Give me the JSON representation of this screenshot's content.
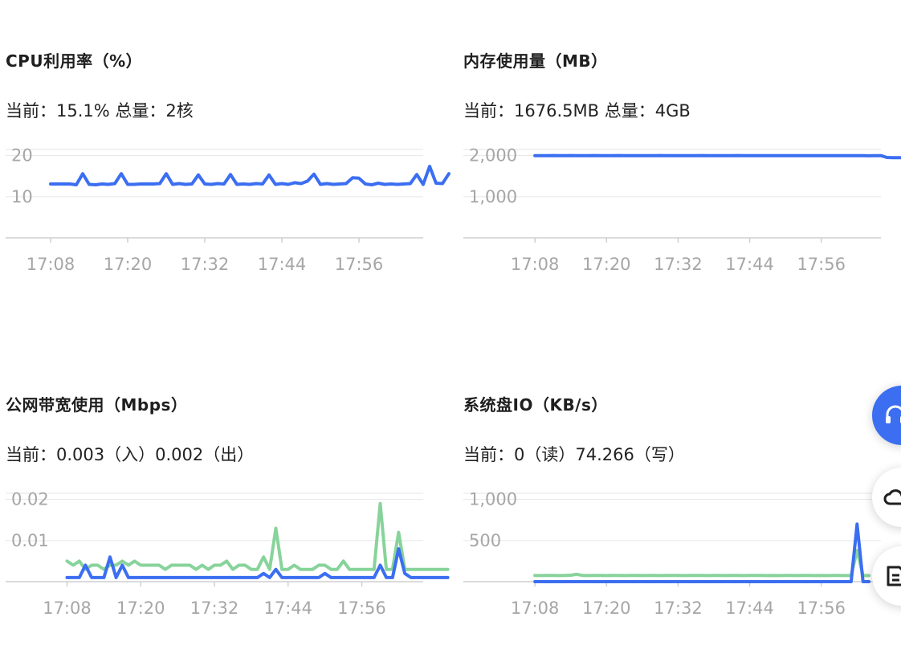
{
  "panels": {
    "cpu": {
      "title": "CPU利用率（%）",
      "current_label": "当前：",
      "current_value": "15.1%",
      "total_label": "总量：",
      "total_value": "2核"
    },
    "mem": {
      "title": "内存使用量（MB）",
      "current_label": "当前：",
      "current_value": "1676.5MB",
      "total_label": "总量：",
      "total_value": "4GB"
    },
    "net": {
      "title": "公网带宽使用（Mbps）",
      "current_label": "当前：",
      "current_in": "0.003（入）",
      "current_out": "0.002（出）"
    },
    "io": {
      "title": "系统盘IO（KB/s）",
      "current_label": "当前：",
      "current_read": "0（读）",
      "current_write": "74.266（写）"
    }
  },
  "colors": {
    "blue": "#3b6ef1",
    "green": "#88d39b",
    "axis_text": "#a6a6a6",
    "grid": "#e6e6e6",
    "axis": "#cfcfcf"
  },
  "fabs": [
    {
      "name": "support",
      "icon": "headset-icon"
    },
    {
      "name": "cloud",
      "icon": "cloud-icon"
    },
    {
      "name": "doc",
      "icon": "document-icon"
    }
  ],
  "chart_data": [
    {
      "id": "cpu",
      "type": "line",
      "title": "CPU利用率（%）",
      "x_start": "17:08",
      "x_step_minutes": 1,
      "xticks": [
        "17:08",
        "17:20",
        "17:32",
        "17:44",
        "17:56"
      ],
      "yticks": [
        10,
        20
      ],
      "ylim": [
        0,
        21.5
      ],
      "xlim_minutes": [
        -7,
        58
      ],
      "grid": true,
      "series": [
        {
          "color": "#3b6ef1",
          "values": [
            13.1,
            13.1,
            13.1,
            13.1,
            12.9,
            15.6,
            13.0,
            12.9,
            13.1,
            13.0,
            13.2,
            15.6,
            13.0,
            13.0,
            13.1,
            13.1,
            13.1,
            13.2,
            15.6,
            13.0,
            13.2,
            13.0,
            13.1,
            15.3,
            13.1,
            13.0,
            13.2,
            13.1,
            15.4,
            13.0,
            13.1,
            13.0,
            13.2,
            13.1,
            15.3,
            13.0,
            13.2,
            13.0,
            13.4,
            13.2,
            13.8,
            15.5,
            13.0,
            13.2,
            13.0,
            13.1,
            13.2,
            14.6,
            14.5,
            13.1,
            12.9,
            13.3,
            13.0,
            13.1,
            13.0,
            13.1,
            13.2,
            15.4,
            13.0,
            17.4,
            13.3,
            13.2,
            15.6
          ]
        }
      ]
    },
    {
      "id": "mem",
      "type": "line",
      "title": "内存使用量（MB）",
      "x_start": "17:08",
      "x_step_minutes": 1,
      "xticks": [
        "17:08",
        "17:20",
        "17:32",
        "17:44",
        "17:56"
      ],
      "yticks": [
        1000,
        2000
      ],
      "ylim": [
        0,
        2150
      ],
      "xlim_minutes": [
        -12,
        58
      ],
      "grid": true,
      "series": [
        {
          "color": "#3b6ef1",
          "values": [
            2000,
            2000,
            2000,
            2001,
            2000,
            2000,
            2001,
            2000,
            2000,
            2000,
            2001,
            2000,
            2000,
            2000,
            2001,
            2000,
            2000,
            2000,
            2000,
            2000,
            2000,
            2001,
            2000,
            2000,
            2000,
            2000,
            2000,
            2000,
            2001,
            2000,
            2000,
            2000,
            2000,
            2000,
            2001,
            2000,
            2000,
            2000,
            2000,
            2000,
            2000,
            2000,
            2000,
            2000,
            2000,
            2000,
            2000,
            2000,
            2000,
            2000,
            2000,
            2000,
            2000,
            2000,
            2000,
            2000,
            1995,
            1998,
            1999,
            1955,
            1950,
            1950,
            1950
          ]
        }
      ]
    },
    {
      "id": "net",
      "type": "line",
      "title": "公网带宽使用（Mbps）",
      "x_start": "17:08",
      "x_step_minutes": 1,
      "xticks": [
        "17:08",
        "17:20",
        "17:32",
        "17:44",
        "17:56"
      ],
      "yticks": [
        0.01,
        0.02
      ],
      "ylim": [
        0,
        0.0215
      ],
      "xlim_minutes": [
        -10,
        58
      ],
      "grid": true,
      "series": [
        {
          "color": "#88d39b",
          "values": [
            0.005,
            0.004,
            0.005,
            0.003,
            0.004,
            0.004,
            0.003,
            0.004,
            0.004,
            0.005,
            0.004,
            0.005,
            0.004,
            0.004,
            0.004,
            0.004,
            0.003,
            0.004,
            0.004,
            0.004,
            0.004,
            0.003,
            0.004,
            0.003,
            0.004,
            0.004,
            0.005,
            0.003,
            0.004,
            0.004,
            0.003,
            0.003,
            0.006,
            0.003,
            0.013,
            0.003,
            0.003,
            0.004,
            0.003,
            0.003,
            0.003,
            0.004,
            0.004,
            0.003,
            0.003,
            0.005,
            0.003,
            0.003,
            0.003,
            0.003,
            0.003,
            0.019,
            0.003,
            0.003,
            0.012,
            0.003,
            0.003,
            0.003,
            0.003,
            0.003,
            0.003,
            0.003,
            0.003
          ]
        },
        {
          "color": "#3b6ef1",
          "values": [
            0.001,
            0.001,
            0.001,
            0.004,
            0.001,
            0.001,
            0.001,
            0.006,
            0.001,
            0.004,
            0.001,
            0.001,
            0.001,
            0.001,
            0.001,
            0.001,
            0.001,
            0.001,
            0.001,
            0.001,
            0.001,
            0.001,
            0.001,
            0.001,
            0.001,
            0.001,
            0.001,
            0.001,
            0.001,
            0.001,
            0.001,
            0.001,
            0.002,
            0.001,
            0.003,
            0.001,
            0.001,
            0.001,
            0.001,
            0.001,
            0.001,
            0.001,
            0.002,
            0.001,
            0.001,
            0.001,
            0.001,
            0.001,
            0.001,
            0.001,
            0.001,
            0.004,
            0.001,
            0.001,
            0.008,
            0.002,
            0.001,
            0.001,
            0.001,
            0.001,
            0.001,
            0.001,
            0.001
          ]
        }
      ]
    },
    {
      "id": "io",
      "type": "line",
      "title": "系统盘IO（KB/s）",
      "x_start": "17:08",
      "x_step_minutes": 1,
      "xticks": [
        "17:08",
        "17:20",
        "17:32",
        "17:44",
        "17:56"
      ],
      "yticks": [
        500,
        1000
      ],
      "ylim": [
        0,
        1075
      ],
      "xlim_minutes": [
        -12,
        58
      ],
      "grid": true,
      "series": [
        {
          "color": "#88d39b",
          "values": [
            75,
            74,
            76,
            75,
            74,
            75,
            78,
            90,
            75,
            74,
            76,
            75,
            74,
            75,
            76,
            74,
            75,
            76,
            74,
            75,
            76,
            74,
            75,
            75,
            76,
            74,
            75,
            76,
            75,
            74,
            76,
            75,
            74,
            75,
            76,
            74,
            75,
            75,
            76,
            74,
            75,
            74,
            76,
            75,
            74,
            75,
            76,
            74,
            75,
            74,
            76,
            75,
            74,
            75,
            380,
            74,
            74
          ]
        },
        {
          "color": "#3b6ef1",
          "values": [
            0,
            0,
            0,
            0,
            0,
            0,
            0,
            0,
            0,
            0,
            0,
            0,
            0,
            0,
            0,
            0,
            0,
            0,
            0,
            0,
            0,
            0,
            0,
            0,
            0,
            0,
            0,
            0,
            0,
            0,
            0,
            0,
            0,
            0,
            0,
            0,
            0,
            0,
            0,
            0,
            0,
            0,
            0,
            0,
            0,
            0,
            0,
            0,
            0,
            0,
            0,
            0,
            0,
            0,
            700,
            0,
            0
          ]
        }
      ]
    }
  ]
}
